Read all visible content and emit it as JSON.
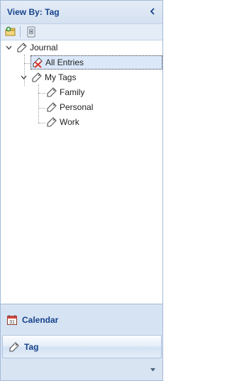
{
  "header": {
    "title": "View By: Tag",
    "collapse_icon": "chevron-left-icon"
  },
  "toolbar": {
    "buttons": [
      {
        "icon": "new-tag-icon"
      },
      {
        "icon": "tag-properties-icon"
      }
    ]
  },
  "tree": {
    "root": {
      "label": "Journal",
      "expanded": true
    },
    "all_entries": {
      "label": "All Entries",
      "selected": true
    },
    "my_tags": {
      "label": "My Tags",
      "expanded": true
    },
    "tags": [
      {
        "label": "Family"
      },
      {
        "label": "Personal"
      },
      {
        "label": "Work"
      }
    ]
  },
  "nav": {
    "calendar": {
      "label": "Calendar",
      "icon": "calendar-icon"
    },
    "tag": {
      "label": "Tag",
      "icon": "tag-icon",
      "active": true
    }
  },
  "colors": {
    "pane_background": "#d8e4f2",
    "title_text": "#15428b",
    "selection_background": "#dbe8fa",
    "border": "#a3bad8"
  }
}
